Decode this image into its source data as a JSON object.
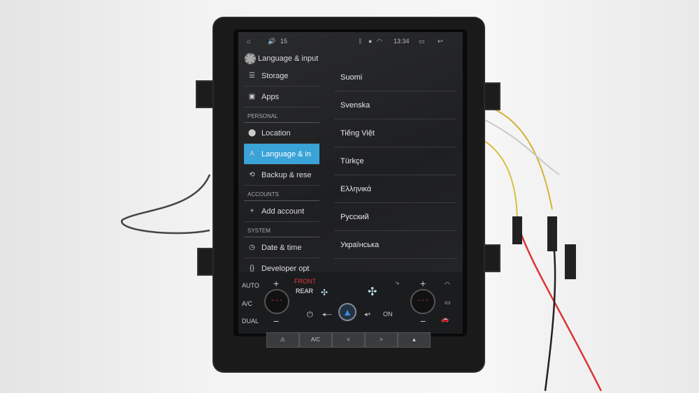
{
  "status_bar": {
    "volume": "15",
    "time": "13:34",
    "icons": [
      "home-icon",
      "volume-icon",
      "bluetooth-icon",
      "location-icon",
      "wifi-icon",
      "recents-icon",
      "back-icon"
    ]
  },
  "header": {
    "title": "Language & input"
  },
  "sidebar": {
    "items": [
      {
        "label": "Storage",
        "icon": "storage-icon"
      },
      {
        "label": "Apps",
        "icon": "apps-icon"
      },
      {
        "section": "PERSONAL"
      },
      {
        "label": "Location",
        "icon": "location-icon"
      },
      {
        "label": "Language & in",
        "icon": "language-icon",
        "selected": true
      },
      {
        "label": "Backup & rese",
        "icon": "backup-icon"
      },
      {
        "section": "ACCOUNTS"
      },
      {
        "label": "Add account",
        "icon": "plus-icon"
      },
      {
        "section": "SYSTEM"
      },
      {
        "label": "Date & time",
        "icon": "clock-icon"
      },
      {
        "label": "Developer opt",
        "icon": "braces-icon"
      }
    ]
  },
  "languages": [
    "Suomi",
    "Svenska",
    "Tiếng Việt",
    "Türkçe",
    "Ελληνικά",
    "Русский",
    "Українська"
  ],
  "climate": {
    "auto": "AUTO",
    "ac": "A/C",
    "dual": "DUAL",
    "front": "FRONT",
    "rear": "REAR",
    "on": "ON",
    "temp_left": "- - -",
    "temp_right": "- - -",
    "plus": "+",
    "minus": "−"
  },
  "hard_buttons": [
    "⚠",
    "A/C",
    "<",
    ">",
    "▲"
  ],
  "colors": {
    "accent": "#3aa3d8",
    "front_label": "#e03a3a"
  }
}
